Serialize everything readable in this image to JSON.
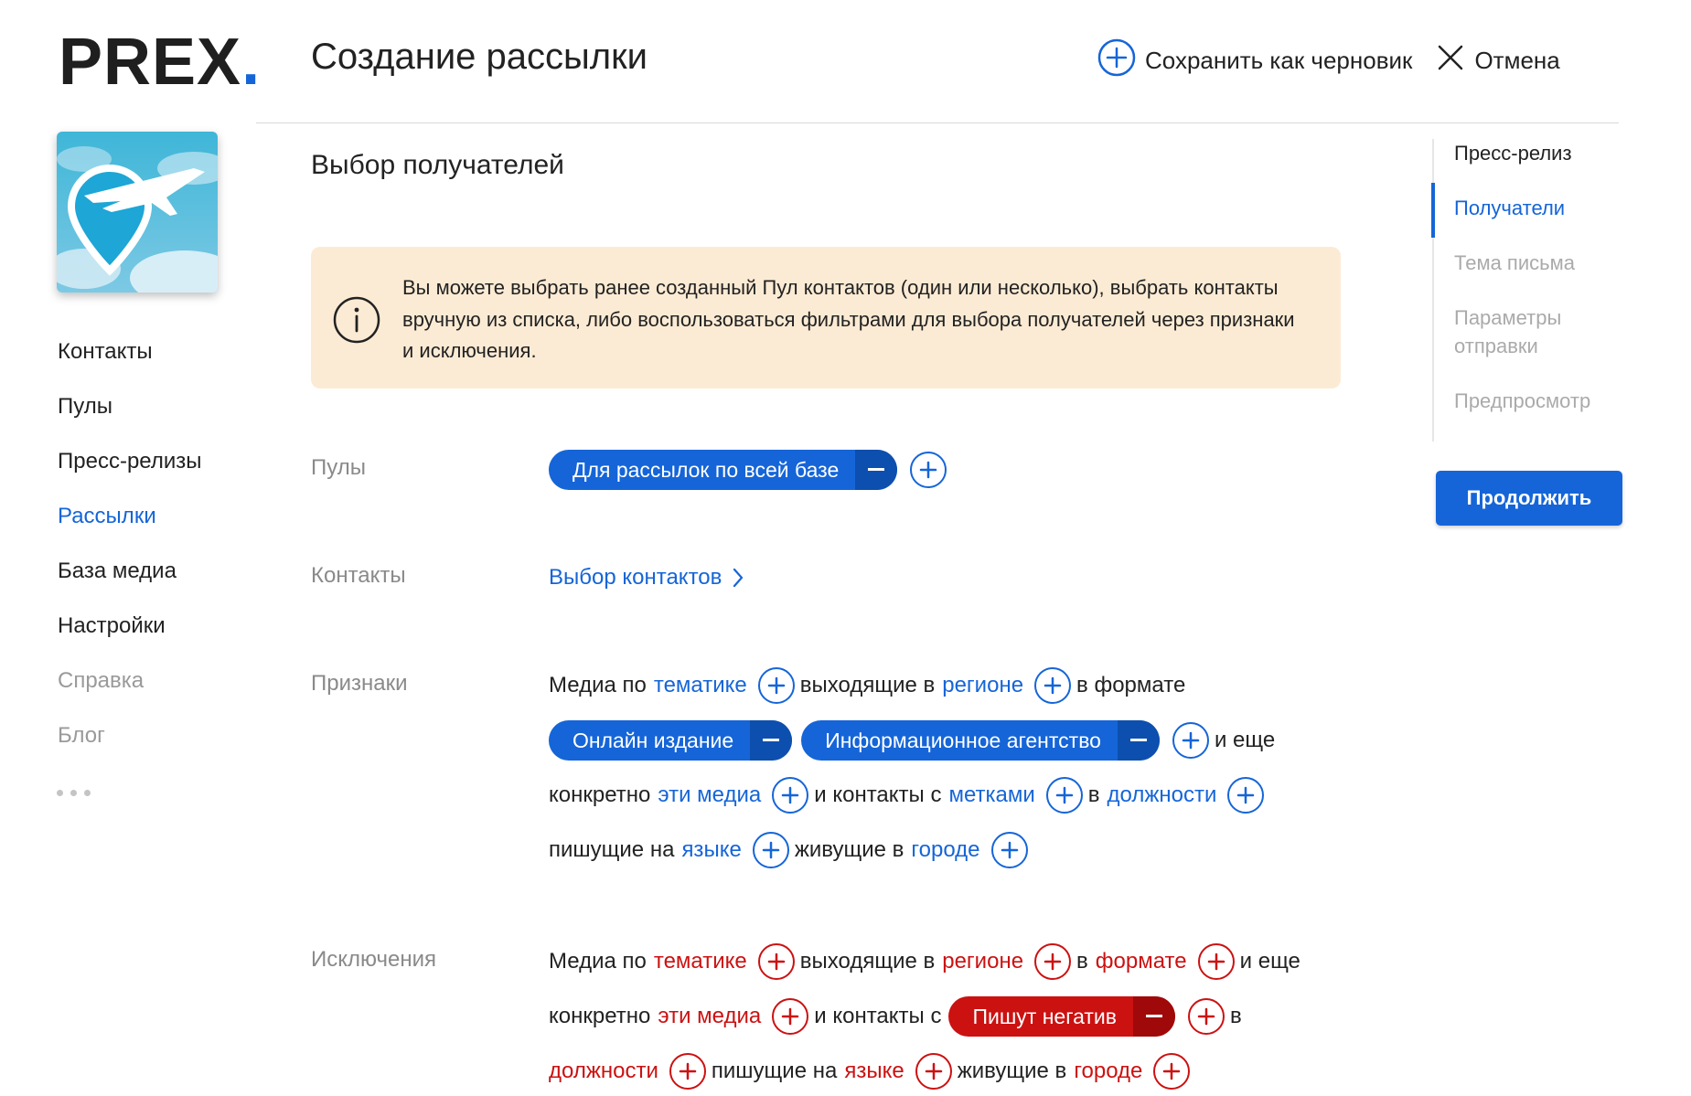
{
  "brand": {
    "logo": "PREX",
    "logo_dot": ".",
    "accent": "#1565d8",
    "exclusion_color": "#cc1111"
  },
  "header": {
    "title": "Создание рассылки",
    "save_draft": "Сохранить как черновик",
    "cancel": "Отмена"
  },
  "sidebar": {
    "items": [
      {
        "label": "Контакты"
      },
      {
        "label": "Пулы"
      },
      {
        "label": "Пресс-релизы"
      },
      {
        "label": "Рассылки"
      },
      {
        "label": "База медиа"
      },
      {
        "label": "Настройки"
      },
      {
        "label": "Справка"
      },
      {
        "label": "Блог"
      }
    ],
    "active": "Рассылки",
    "more_icon": "more-dots-icon"
  },
  "main": {
    "section_title": "Выбор получателей",
    "info": "Вы можете выбрать ранее созданный Пул контактов (один или несколько), выбрать контакты вручную из списка, либо воспользоваться фильтрами для выбора получателей через признаки и исключения.",
    "pools": {
      "label": "Пулы",
      "chips": [
        "Для рассылок по всей базе"
      ]
    },
    "contacts": {
      "label": "Контакты",
      "link": "Выбор контактов"
    },
    "features": {
      "label": "Признаки",
      "t_media_by": "Медиа по",
      "l_topic": "тематике",
      "t_coming_in": "выходящие в",
      "l_region": "регионе",
      "t_in_format": "в формате",
      "chips": [
        "Онлайн издание",
        "Информационное агентство"
      ],
      "t_and_more": "и еще",
      "t_specifically": "конкретно",
      "l_these_media": "эти медиа",
      "t_and_contacts_with": "и контакты с",
      "l_tags": "метками",
      "t_in": "в",
      "l_positions": "должности",
      "t_writing_in": "пишущие на",
      "l_language": "языке",
      "t_living_in": "живущие в",
      "l_city": "городе"
    },
    "exclusions": {
      "label": "Исключения",
      "t_media_by": "Медиа по",
      "l_topic": "тематике",
      "t_coming_in": "выходящие в",
      "l_region": "регионе",
      "t_in": "в",
      "l_format": "формате",
      "t_and_more": "и еще",
      "t_specifically": "конкретно",
      "l_these_media": "эти медиа",
      "t_and_contacts_with": "и контакты с",
      "chips": [
        "Пишут негатив"
      ],
      "t_in2": "в",
      "l_positions": "должности",
      "t_writing_in": "пишущие на",
      "l_language": "языке",
      "t_living_in": "живущие в",
      "l_city": "городе"
    }
  },
  "steps": {
    "items": [
      {
        "label": "Пресс-релиз"
      },
      {
        "label": "Получатели"
      },
      {
        "label": "Тема письма"
      },
      {
        "label": "Параметры отправки"
      },
      {
        "label": "Предпросмотр"
      }
    ],
    "active": "Получатели"
  },
  "continue_button": "Продолжить"
}
